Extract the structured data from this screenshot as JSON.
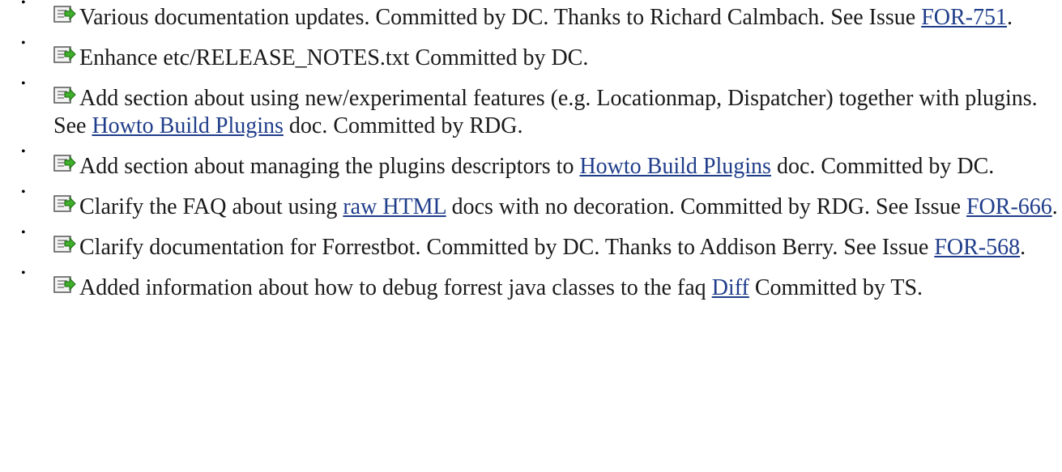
{
  "changes": [
    {
      "parts": [
        {
          "t": "Various documentation updates. Committed by DC. Thanks to Richard Calmbach. See Issue "
        },
        {
          "t": "FOR-751",
          "link": true
        },
        {
          "t": "."
        }
      ]
    },
    {
      "parts": [
        {
          "t": "Enhance etc/RELEASE_NOTES.txt Committed by DC."
        }
      ]
    },
    {
      "parts": [
        {
          "t": "Add section about using new/experimental features (e.g. Locationmap, Dispatcher) together with plugins. See "
        },
        {
          "t": "Howto Build Plugins",
          "link": true
        },
        {
          "t": " doc. Committed by RDG."
        }
      ]
    },
    {
      "parts": [
        {
          "t": "Add section about managing the plugins descriptors to "
        },
        {
          "t": "Howto Build Plugins",
          "link": true
        },
        {
          "t": " doc. Committed by DC."
        }
      ]
    },
    {
      "parts": [
        {
          "t": "Clarify the FAQ about using "
        },
        {
          "t": "raw HTML",
          "link": true
        },
        {
          "t": " docs with no decoration. Committed by RDG. See Issue "
        },
        {
          "t": "FOR-666",
          "link": true
        },
        {
          "t": "."
        }
      ]
    },
    {
      "parts": [
        {
          "t": "Clarify documentation for Forrestbot. Committed by DC. Thanks to Addison Berry. See Issue "
        },
        {
          "t": "FOR-568",
          "link": true
        },
        {
          "t": "."
        }
      ]
    },
    {
      "parts": [
        {
          "t": "Added information about how to debug forrest java classes to the faq "
        },
        {
          "t": "Diff",
          "link": true
        },
        {
          "t": " Committed by TS."
        }
      ]
    }
  ],
  "icon": "update-doc-icon",
  "colors": {
    "link": "#1f3d8a",
    "text": "#1a1a1a"
  }
}
